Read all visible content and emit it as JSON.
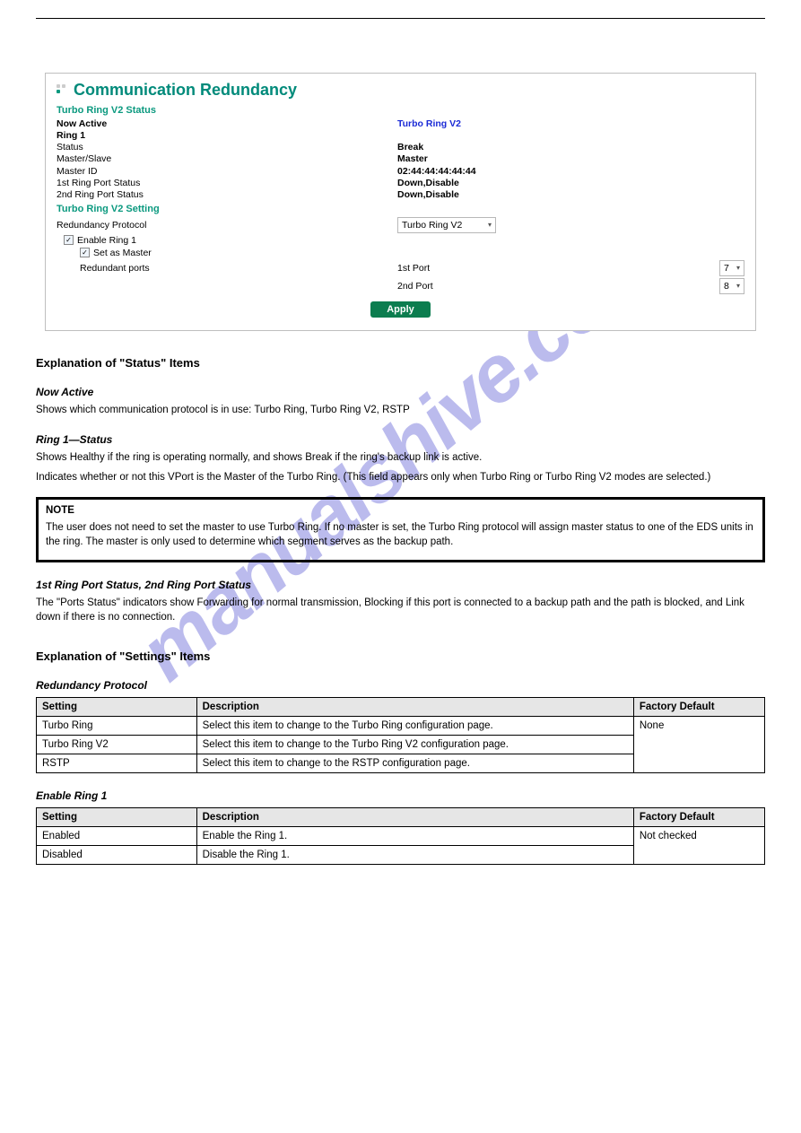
{
  "watermark": "manualshive.com",
  "panel": {
    "title": "Communication Redundancy",
    "status_head": "Turbo Ring V2 Status",
    "now_active_label": "Now Active",
    "now_active_value": "Turbo Ring V2",
    "ring1_label": "Ring 1",
    "rows": [
      {
        "label": "Status",
        "value": "Break"
      },
      {
        "label": "Master/Slave",
        "value": "Master"
      },
      {
        "label": "Master ID",
        "value": "02:44:44:44:44:44"
      },
      {
        "label": "1st Ring Port Status",
        "value": "Down,Disable"
      },
      {
        "label": "2nd Ring Port Status",
        "value": "Down,Disable"
      }
    ],
    "setting_head": "Turbo Ring V2 Setting",
    "protocol_label": "Redundancy Protocol",
    "protocol_value": "Turbo Ring V2",
    "enable_ring1": "Enable Ring 1",
    "set_master": "Set as Master",
    "redundant_ports": "Redundant ports",
    "port1_label": "1st Port",
    "port1_value": "7",
    "port2_label": "2nd Port",
    "port2_value": "8",
    "apply": "Apply"
  },
  "explain_title": "Explanation of \"Status\" Items",
  "explain": {
    "now_active_h": "Now Active",
    "now_active_p": "Shows which communication protocol is in use: Turbo Ring, Turbo Ring V2, RSTP",
    "ring_h": "Ring 1—Status",
    "ring_p1": "Shows Healthy if the ring is operating normally, and shows Break if the ring's backup link is active.",
    "master_slave_p": "Indicates whether or not this VPort is the Master of the Turbo Ring. (This field appears only when Turbo Ring or Turbo Ring V2 modes are selected.)"
  },
  "note": {
    "h": "NOTE",
    "p": "The user does not need to set the master to use Turbo Ring. If no master is set, the Turbo Ring protocol will assign master status to one of the EDS units in the ring. The master is only used to determine which segment serves as the backup path."
  },
  "portstatus": {
    "h": "1st Ring Port Status, 2nd Ring Port Status",
    "p1": "The \"Ports Status\" indicators show Forwarding for normal transmission, Blocking if this port is connected to a backup path and the path is blocked, and Link down if there is no connection."
  },
  "settings_title": "Explanation of \"Settings\" Items",
  "proto_subhead": "Redundancy Protocol",
  "table1": {
    "h": [
      "Setting",
      "Description",
      "Factory Default"
    ],
    "rows": [
      [
        "Turbo Ring",
        "Select this item to change to the Turbo Ring configuration page.",
        "None"
      ],
      [
        "Turbo Ring V2",
        "Select this item to change to the Turbo Ring V2 configuration page.",
        ""
      ],
      [
        "RSTP",
        "Select this item to change to the RSTP configuration page.",
        ""
      ]
    ]
  },
  "er1_subhead": "Enable Ring 1",
  "table2": {
    "h": [
      "Setting",
      "Description",
      "Factory Default"
    ],
    "rows": [
      [
        "Enabled",
        "Enable the Ring 1.",
        "Not checked"
      ],
      [
        "Disabled",
        "Disable the Ring 1.",
        ""
      ]
    ]
  }
}
